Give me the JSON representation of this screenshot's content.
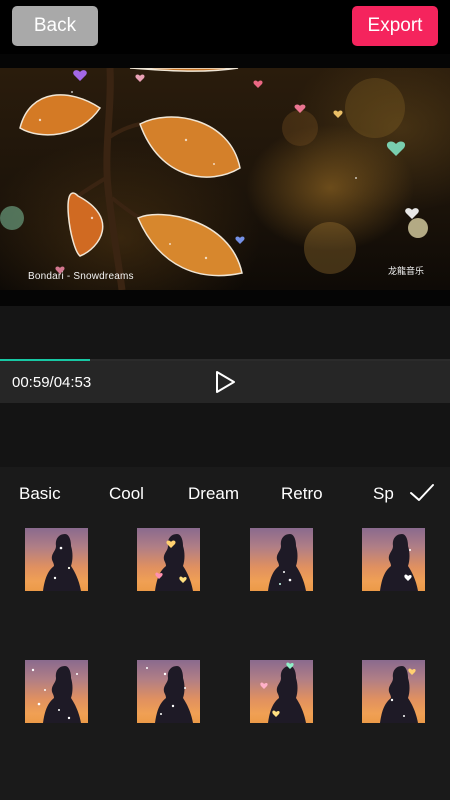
{
  "header": {
    "back_label": "Back",
    "export_label": "Export",
    "export_color": "#f5245d"
  },
  "video": {
    "caption": "Bondari - Snowdreams",
    "watermark": "龙龍音乐"
  },
  "player": {
    "time": "00:59/04:53",
    "progress": 0.2,
    "accent": "#18c8a4",
    "play_icon": "play-icon"
  },
  "effects": {
    "tabs": [
      "Basic",
      "Cool",
      "Dream",
      "Retro",
      "Sp"
    ],
    "confirm_icon": "checkmark-icon",
    "items_count_visible": 8
  }
}
